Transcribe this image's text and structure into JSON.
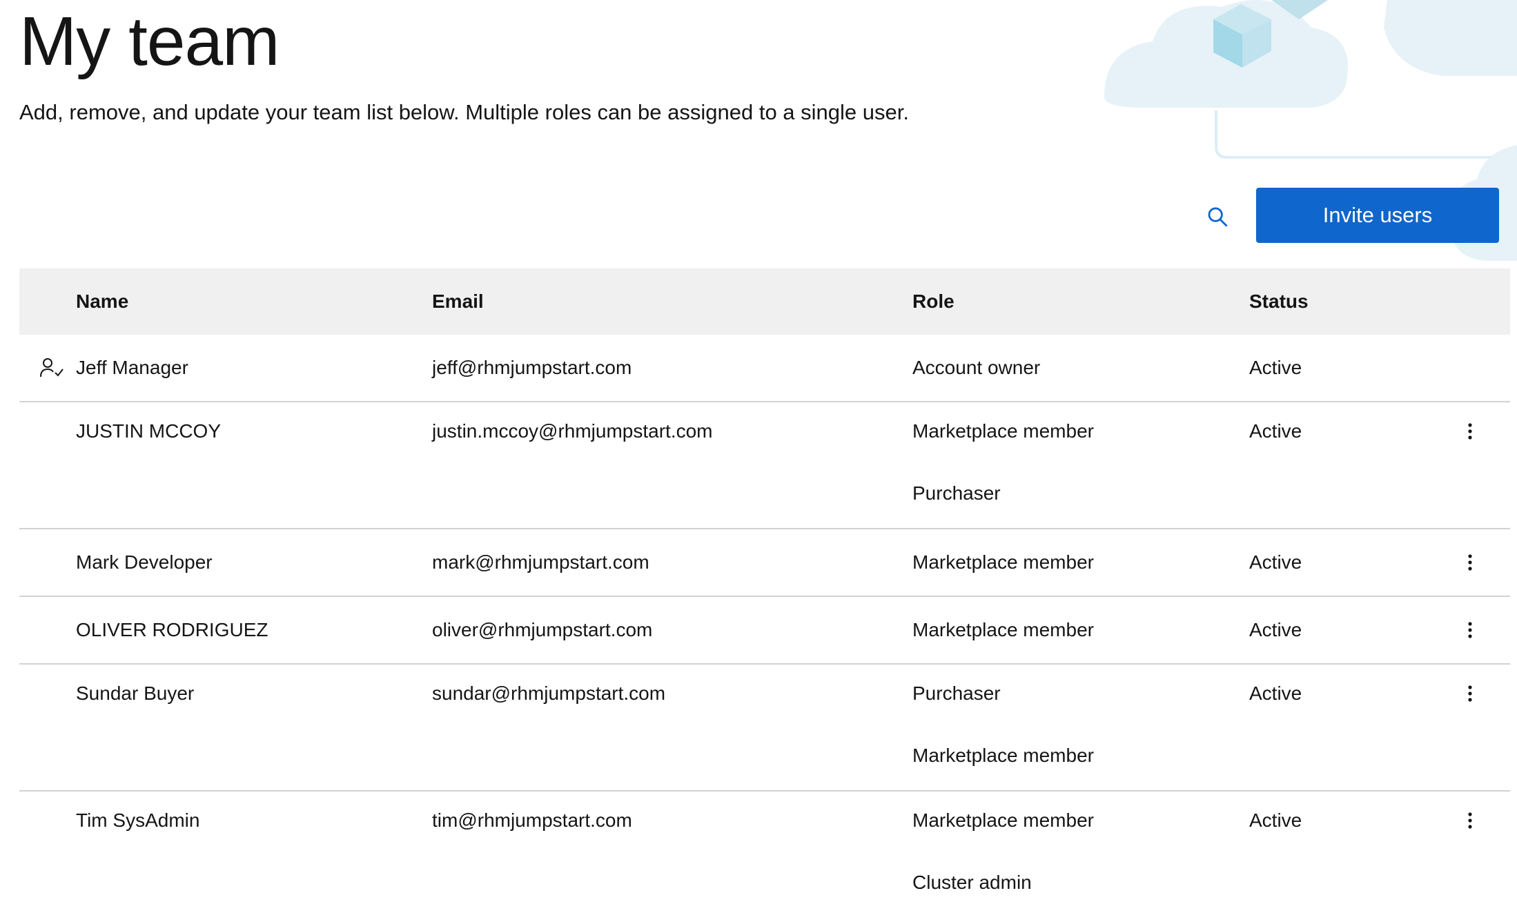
{
  "header": {
    "title": "My team",
    "description": "Add, remove, and update your team list below. Multiple roles can be assigned to a single user."
  },
  "toolbar": {
    "search_icon": "search-icon",
    "invite_label": "Invite users",
    "accent_color": "#0f66cc"
  },
  "table": {
    "columns": [
      "Name",
      "Email",
      "Role",
      "Status"
    ],
    "rows": [
      {
        "name": "Jeff Manager",
        "email": "jeff@rhmjumpstart.com",
        "roles": [
          "Account owner"
        ],
        "status": "Active",
        "owner_icon": "user-check-icon",
        "has_actions": false
      },
      {
        "name": "JUSTIN MCCOY",
        "email": "justin.mccoy@rhmjumpstart.com",
        "roles": [
          "Marketplace member",
          "Purchaser"
        ],
        "status": "Active",
        "has_actions": true
      },
      {
        "name": "Mark Developer",
        "email": "mark@rhmjumpstart.com",
        "roles": [
          "Marketplace member"
        ],
        "status": "Active",
        "has_actions": true
      },
      {
        "name": "OLIVER RODRIGUEZ",
        "email": "oliver@rhmjumpstart.com",
        "roles": [
          "Marketplace member"
        ],
        "status": "Active",
        "has_actions": true
      },
      {
        "name": "Sundar Buyer",
        "email": "sundar@rhmjumpstart.com",
        "roles": [
          "Purchaser",
          "Marketplace member"
        ],
        "status": "Active",
        "has_actions": true
      },
      {
        "name": "Tim SysAdmin",
        "email": "tim@rhmjumpstart.com",
        "roles": [
          "Marketplace member",
          "Cluster admin"
        ],
        "status": "Active",
        "has_actions": true
      }
    ],
    "row_actions_icon": "kebab-menu-icon"
  }
}
